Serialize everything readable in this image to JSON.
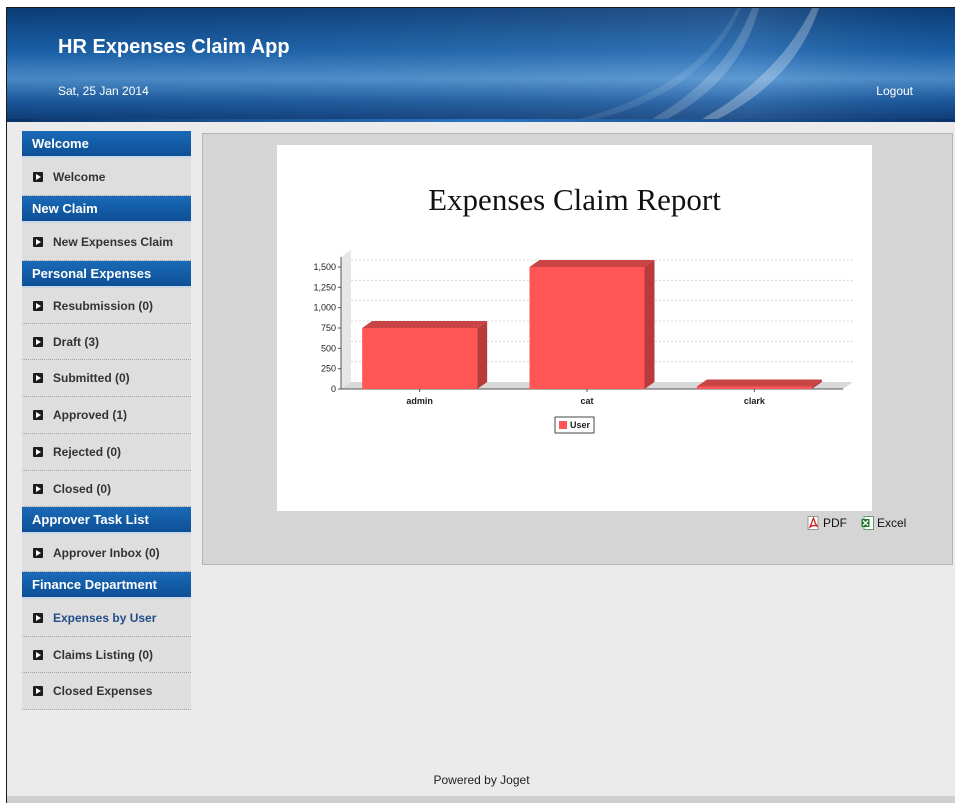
{
  "header": {
    "title": "HR Expenses Claim App",
    "date": "Sat, 25 Jan 2014",
    "logout_label": "Logout"
  },
  "sidebar": {
    "sections": [
      {
        "title": "Welcome",
        "items": [
          {
            "label": "Welcome"
          }
        ]
      },
      {
        "title": "New Claim",
        "items": [
          {
            "label": "New Expenses Claim"
          }
        ]
      },
      {
        "title": "Personal Expenses",
        "items": [
          {
            "label": "Resubmission (0)"
          },
          {
            "label": "Draft (3)"
          },
          {
            "label": "Submitted (0)"
          },
          {
            "label": "Approved (1)"
          },
          {
            "label": "Rejected (0)"
          },
          {
            "label": "Closed (0)"
          }
        ]
      },
      {
        "title": "Approver Task List",
        "items": [
          {
            "label": "Approver Inbox (0)"
          }
        ]
      },
      {
        "title": "Finance Department",
        "items": [
          {
            "label": "Expenses by User",
            "active": true
          },
          {
            "label": "Claims Listing (0)"
          },
          {
            "label": "Closed Expenses"
          }
        ]
      }
    ]
  },
  "chart_data": {
    "type": "bar",
    "title": "Expenses Claim Report",
    "categories": [
      "admin",
      "cat",
      "clark"
    ],
    "series": [
      {
        "name": "User",
        "values": [
          750,
          1500,
          30
        ],
        "color": "#ff5555"
      }
    ],
    "ylim": [
      0,
      1500
    ],
    "yticks": [
      "0",
      "250",
      "500",
      "750",
      "1,000",
      "1,250",
      "1,500"
    ],
    "grid": true,
    "legend": "bottom"
  },
  "export": {
    "pdf_label": "PDF",
    "excel_label": "Excel"
  },
  "footer": {
    "text": "Powered by Joget"
  }
}
